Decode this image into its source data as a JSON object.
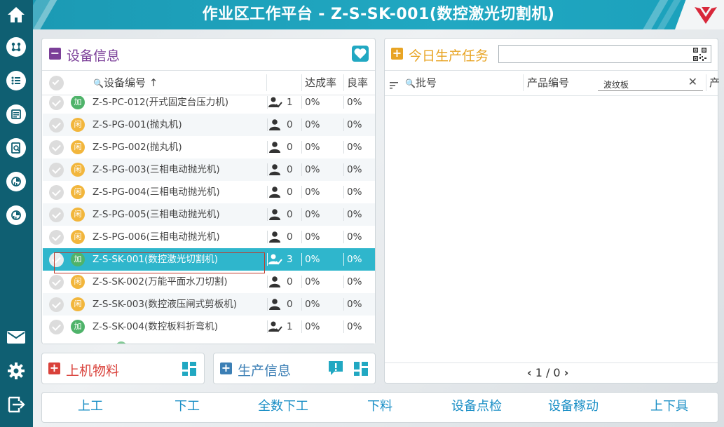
{
  "header": {
    "title": "作业区工作平台 - Z-S-SK-001(数控激光切割机)"
  },
  "sidebar": {
    "items": [
      "home-icon",
      "workflow-icon",
      "list-icon",
      "report-icon",
      "search-doc-icon",
      "dashboard-icon",
      "settings-gauge-icon",
      "mail-icon",
      "gear-icon",
      "logout-icon"
    ]
  },
  "device_panel": {
    "title": "设备信息",
    "columns": {
      "code": "设备编号",
      "rate": "达成率",
      "yield": "良率"
    },
    "rows": [
      {
        "tag": "加",
        "status": "work",
        "name": "Z-S-PC-012(开式固定台压力机)",
        "count": "1",
        "rate": "0%",
        "yield": "0%",
        "person": "person-check-icon"
      },
      {
        "tag": "闲",
        "status": "idle",
        "name": "Z-S-PG-001(抛丸机)",
        "count": "0",
        "rate": "0%",
        "yield": "0%",
        "person": "person-icon"
      },
      {
        "tag": "闲",
        "status": "idle",
        "name": "Z-S-PG-002(抛丸机)",
        "count": "0",
        "rate": "0%",
        "yield": "0%",
        "person": "person-icon"
      },
      {
        "tag": "闲",
        "status": "idle",
        "name": "Z-S-PG-003(三相电动抛光机)",
        "count": "0",
        "rate": "0%",
        "yield": "0%",
        "person": "person-icon"
      },
      {
        "tag": "闲",
        "status": "idle",
        "name": "Z-S-PG-004(三相电动抛光机)",
        "count": "0",
        "rate": "0%",
        "yield": "0%",
        "person": "person-icon"
      },
      {
        "tag": "闲",
        "status": "idle",
        "name": "Z-S-PG-005(三相电动抛光机)",
        "count": "0",
        "rate": "0%",
        "yield": "0%",
        "person": "person-icon"
      },
      {
        "tag": "闲",
        "status": "idle",
        "name": "Z-S-PG-006(三相电动抛光机)",
        "count": "0",
        "rate": "0%",
        "yield": "0%",
        "person": "person-icon"
      },
      {
        "tag": "加",
        "status": "work",
        "name": "Z-S-SK-001(数控激光切割机)",
        "count": "3",
        "rate": "0%",
        "yield": "0%",
        "person": "person-check-icon",
        "selected": true
      },
      {
        "tag": "闲",
        "status": "idle",
        "name": "Z-S-SK-002(万能平面水刀切割)",
        "count": "0",
        "rate": "0%",
        "yield": "0%",
        "person": "person-icon"
      },
      {
        "tag": "闲",
        "status": "idle",
        "name": "Z-S-SK-003(数控液压闸式剪板机)",
        "count": "0",
        "rate": "0%",
        "yield": "0%",
        "person": "person-icon"
      },
      {
        "tag": "加",
        "status": "work",
        "name": "Z-S-SK-004(数控板料折弯机)",
        "count": "1",
        "rate": "0%",
        "yield": "0%",
        "person": "person-check-icon"
      }
    ]
  },
  "material_panel": {
    "title": "上机物料"
  },
  "production_info_panel": {
    "title": "生产信息"
  },
  "task_panel": {
    "title": "今日生产任务",
    "search_value": "",
    "columns": {
      "batch": "批号",
      "product": "产品编号",
      "filter_value": "波纹板",
      "more": "产"
    },
    "pagination": "1 / 0"
  },
  "toolbar": {
    "buttons": [
      "上工",
      "下工",
      "全数下工",
      "下料",
      "设备点检",
      "设备稼动",
      "上下具"
    ]
  },
  "colors": {
    "sidebar": "#0f5f72",
    "header": "#21a8c2",
    "selected_row": "#2fb6cc",
    "device_title": "#7b3f98",
    "task_title": "#e8a424",
    "material_title": "#d9413a",
    "production_title": "#3c7fb5",
    "toolbar_text": "#1b8fc6"
  }
}
